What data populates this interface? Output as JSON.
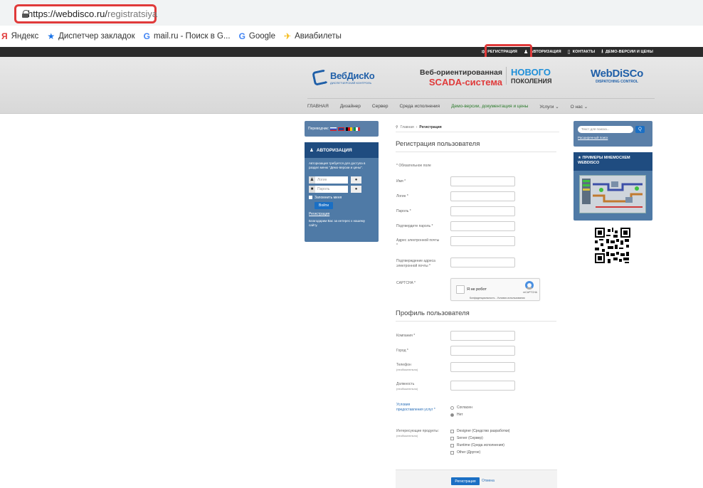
{
  "browser": {
    "url_domain": "https://webdisco.ru/",
    "url_path": "registratsiya",
    "bookmarks": [
      {
        "icon": "yandex-icon",
        "glyph": "Я",
        "label": "Яндекс"
      },
      {
        "icon": "star-icon",
        "glyph": "★",
        "label": "Диспетчер закладок"
      },
      {
        "icon": "google-icon",
        "glyph": "G",
        "label": "mail.ru - Поиск в G..."
      },
      {
        "icon": "google-icon",
        "glyph": "G",
        "label": "Google"
      },
      {
        "icon": "plane-icon",
        "glyph": "✈",
        "label": "Авиабилеты"
      }
    ]
  },
  "topnav": [
    {
      "icon": "gear-icon",
      "glyph": "✲",
      "label": "РЕГИСТРАЦИЯ"
    },
    {
      "icon": "user-icon",
      "glyph": "♟",
      "label": "АВТОРИЗАЦИЯ"
    },
    {
      "icon": "document-icon",
      "glyph": "▯",
      "label": "КОНТАКТЫ"
    },
    {
      "icon": "download-icon",
      "glyph": "⭳",
      "label": "ДЕМО-ВЕРСИИ И ЦЕНЫ"
    }
  ],
  "header": {
    "logo_ru_name": "ВебДисКо",
    "logo_ru_sub": "диспетчерский контроль",
    "tagline_1": "Веб-ориентированная",
    "tagline_2": "SCADA-система",
    "new_1": "НОВОГО",
    "new_2": "ПОКОЛЕНИЯ",
    "logo_en_name": "WebDiSCo",
    "logo_en_sub": "DISPATCHING CONTROL"
  },
  "mainnav": [
    "ГЛАВНАЯ",
    "Дизайнер",
    "Сервер",
    "Среда исполнения",
    "Демо-версии, документация и цены",
    "Услуги ⌄",
    "О нас ⌄"
  ],
  "left": {
    "translate_label": "Переводчик:",
    "auth_title": "АВТОРИЗАЦИЯ",
    "auth_note": "Авторизация требуется для доступа в раздел меню \"Демо-версии и цены\".",
    "login_placeholder": "Логин",
    "password_placeholder": "Пароль",
    "remember": "Запомнить меня",
    "login_button": "Войти",
    "register_link": "Регистрация",
    "thanks": "Благодарим Вас за интерес к нашему сайту."
  },
  "breadcrumb": {
    "home": "Главная",
    "sep": "›",
    "current": "Регистрация"
  },
  "form": {
    "reg_title": "Регистрация пользователя",
    "required_note": "* Обязательное поле",
    "fields": [
      {
        "label": "Имя *",
        "hint": ""
      },
      {
        "label": "Логин *",
        "hint": ""
      },
      {
        "label": "Пароль *",
        "hint": ""
      },
      {
        "label": "Подтвердите пароль *",
        "hint": ""
      },
      {
        "label": "Адрес электронной почты *",
        "hint": ""
      },
      {
        "label": "Подтверждение адреса электронной почты *",
        "hint": ""
      }
    ],
    "captcha_label": "CAPTCHA *",
    "captcha_text": "Я не робот",
    "captcha_brand": "reCAPTCHA",
    "captcha_privacy": "Конфиденциальность - Условия использования",
    "profile_title": "Профиль пользователя",
    "profile_fields": [
      {
        "label": "Компания *",
        "hint": ""
      },
      {
        "label": "Город *",
        "hint": ""
      },
      {
        "label": "Телефон",
        "hint": "(необязательно)"
      },
      {
        "label": "Должность",
        "hint": "(необязательно)"
      }
    ],
    "terms_label": "Условия предоставления услуг *",
    "terms_options": [
      "Согласен",
      "Нет"
    ],
    "interest_label": "Интересующие продукты:",
    "interest_hint": "(необязательно)",
    "interest_options": [
      "Designer (Средство разработки)",
      "Server (Сервер)",
      "Runtime (Среда исполнения)",
      "Other (Другое)"
    ],
    "submit": "Регистрация",
    "cancel": "Отмена"
  },
  "right": {
    "search_placeholder": "Текст для поиска...",
    "search_btn": "Q",
    "adv_search": "Расширенный поиск",
    "examples_title": "ПРИМЕРЫ МНЕМОСХЕМ WEBDISCO"
  }
}
